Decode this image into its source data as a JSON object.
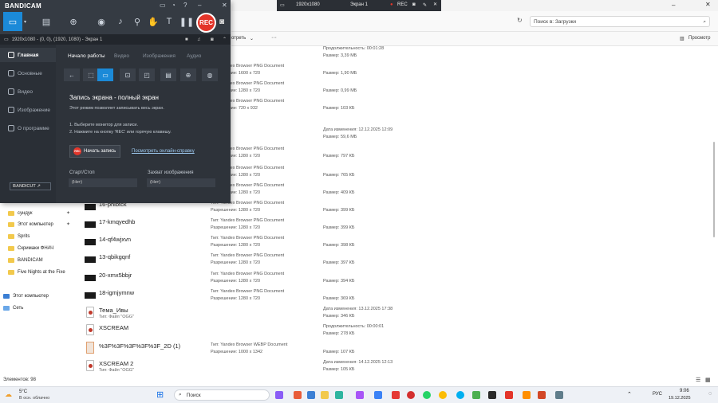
{
  "explorer": {
    "search_placeholder": "Поиск в: Загрузки",
    "toolbar_view": "отреть",
    "toolbar_preview": "Просмотр",
    "nav_items": [
      {
        "label": "сундук",
        "icon": "folder-icon",
        "pinned": true
      },
      {
        "label": "Этот компьютер",
        "icon": "folder-icon",
        "pinned": true
      },
      {
        "label": "Sprits",
        "icon": "folder-icon",
        "pinned": false
      },
      {
        "label": "Скримаки ФНАЧ",
        "icon": "folder-icon",
        "pinned": false
      },
      {
        "label": "BANDICAM",
        "icon": "folder-icon",
        "pinned": false
      },
      {
        "label": "Five Nights at the Fixe",
        "icon": "folder-icon",
        "pinned": false
      },
      {
        "label": "Этот компьютер",
        "icon": "pc-icon",
        "pinned": false
      },
      {
        "label": "Сеть",
        "icon": "network-icon",
        "pinned": false
      }
    ],
    "status": "Элементов: 98",
    "files": [
      {
        "name": "",
        "sub": "",
        "c1a": "",
        "c1b": "",
        "c2a": "Продолжительность: 00:01:28",
        "c2b": "Размер: 3,39 МБ",
        "icon": "none"
      },
      {
        "name": "",
        "sub": "",
        "c1a": "Тип: Yandex Browser PNG Document",
        "c1b": "Разрешение: 1600 x 720",
        "c2a": "",
        "c2b": "Размер: 1,90 МБ",
        "icon": "none"
      },
      {
        "name": "",
        "sub": "",
        "c1a": "Тип: Yandex Browser PNG Document",
        "c1b": "Разрешение: 1280 x 720",
        "c2a": "",
        "c2b": "Размер: 0,99 МБ",
        "icon": "none"
      },
      {
        "name": "",
        "sub": "",
        "c1a": "Тип: Yandex Browser PNG Document",
        "c1b": "Разрешение: 720 x 932",
        "c2a": "",
        "c2b": "Размер: 103 КБ",
        "icon": "none"
      },
      {
        "name": "",
        "sub": "",
        "c1a": "",
        "c1b": "",
        "c2a": "Дата изменения: 12.12.2025 12:09",
        "c2b": "Размер: 59,6 МБ",
        "icon": "none"
      },
      {
        "name": "",
        "sub": "",
        "c1a": "Тип: Yandex Browser PNG Document",
        "c1b": "Разрешение: 1280 x 720",
        "c2a": "",
        "c2b": "Размер: 797 КБ",
        "icon": "none"
      },
      {
        "name": "",
        "sub": "",
        "c1a": "Тип: Yandex Browser PNG Document",
        "c1b": "Разрешение: 1280 x 720",
        "c2a": "",
        "c2b": "Размер: 765 КБ",
        "icon": "none"
      },
      {
        "name": "",
        "sub": "",
        "c1a": "Тип: Yandex Browser PNG Document",
        "c1b": "Разрешение: 1280 x 720",
        "c2a": "",
        "c2b": "Размер: 409 КБ",
        "icon": "none"
      },
      {
        "name": "16-phlbtck",
        "sub": "",
        "c1a": "Тип: Yandex Browser PNG Document",
        "c1b": "Разрешение: 1280 x 720",
        "c2a": "",
        "c2b": "Размер: 399 КБ",
        "icon": "thumb"
      },
      {
        "name": "17-kmqyedhb",
        "sub": "",
        "c1a": "Тип: Yandex Browser PNG Document",
        "c1b": "Разрешение: 1280 x 720",
        "c2a": "",
        "c2b": "Размер: 399 КБ",
        "icon": "thumb"
      },
      {
        "name": "14-qf4wjxvn",
        "sub": "",
        "c1a": "Тип: Yandex Browser PNG Document",
        "c1b": "Разрешение: 1280 x 720",
        "c2a": "",
        "c2b": "Размер: 398 КБ",
        "icon": "thumb"
      },
      {
        "name": "13-qbikgqnf",
        "sub": "",
        "c1a": "Тип: Yandex Browser PNG Document",
        "c1b": "Разрешение: 1280 x 720",
        "c2a": "",
        "c2b": "Размер: 397 КБ",
        "icon": "thumb"
      },
      {
        "name": "20-xmx5bbjr",
        "sub": "",
        "c1a": "Тип: Yandex Browser PNG Document",
        "c1b": "Разрешение: 1280 x 720",
        "c2a": "",
        "c2b": "Размер: 394 КБ",
        "icon": "thumb"
      },
      {
        "name": "18-igmjymnw",
        "sub": "",
        "c1a": "Тип: Yandex Browser PNG Document",
        "c1b": "Разрешение: 1280 x 720",
        "c2a": "",
        "c2b": "Размер: 369 КБ",
        "icon": "thumb"
      },
      {
        "name": "Тема_Ивы",
        "sub": "Тип: Файл \"OGG\"",
        "c1a": "",
        "c1b": "",
        "c2a": "Дата изменения: 13.12.2025 17:38",
        "c2b": "Размер: 346 КБ",
        "icon": "ogg"
      },
      {
        "name": "XSCREAM",
        "sub": "",
        "c1a": "",
        "c1b": "",
        "c2a": "Продолжительность: 00:00:01",
        "c2b": "Размер: 278 КБ",
        "icon": "ogg"
      },
      {
        "name": "%3F%3F%3F%3F%3F_2D (1)",
        "sub": "",
        "c1a": "Тип: Yandex Browser WEBP Document",
        "c1b": "Разрешение: 1000 x 1342",
        "c2a": "",
        "c2b": "Размер: 107 КБ",
        "icon": "webp"
      },
      {
        "name": "XSCREAM 2",
        "sub": "Тип: Файл \"OGG\"",
        "c1a": "",
        "c1b": "",
        "c2a": "Дата изменения: 14.12.2025 12:13",
        "c2b": "Размер: 105 КБ",
        "icon": "ogg"
      }
    ]
  },
  "bandicam": {
    "logo": "BANDICAM",
    "info": "1920x1080 - (0, 0), (1920, 1080) - Экран 1",
    "rec_label": "REC",
    "side_items": [
      {
        "label": "Главная",
        "active": true
      },
      {
        "label": "Основные",
        "active": false
      },
      {
        "label": "Видео",
        "active": false
      },
      {
        "label": "Изображение",
        "active": false
      },
      {
        "label": "О программе",
        "active": false
      }
    ],
    "bandicut_label": "BANDICUT ↗",
    "tabs": [
      "Начало работы",
      "Видео",
      "Изображения",
      "Аудио"
    ],
    "heading": "Запись экрана - полный экран",
    "desc": "Этот режим позволяет записывать весь экран.",
    "step1": "1. Выберите монитор для записи.",
    "step2": "2. Нажмите на кнопку 'REC' или горячую клавишу.",
    "start_button": "Начать запись",
    "help_link": "Посмотреть онлайн-справку",
    "hotkey1_label": "Старт/Стоп",
    "hotkey1_value": "(Нет)",
    "hotkey2_label": "Захват изображения",
    "hotkey2_value": "(Нет)"
  },
  "recbar": {
    "resolution": "1920x1080",
    "screen": "Экран 1",
    "rec": "REC"
  },
  "taskbar": {
    "weather_temp": "5°C",
    "weather_desc": "В осн. облачно",
    "search": "Поиск",
    "lang": "РУС",
    "time": "9:06",
    "date": "19.12.2025"
  }
}
